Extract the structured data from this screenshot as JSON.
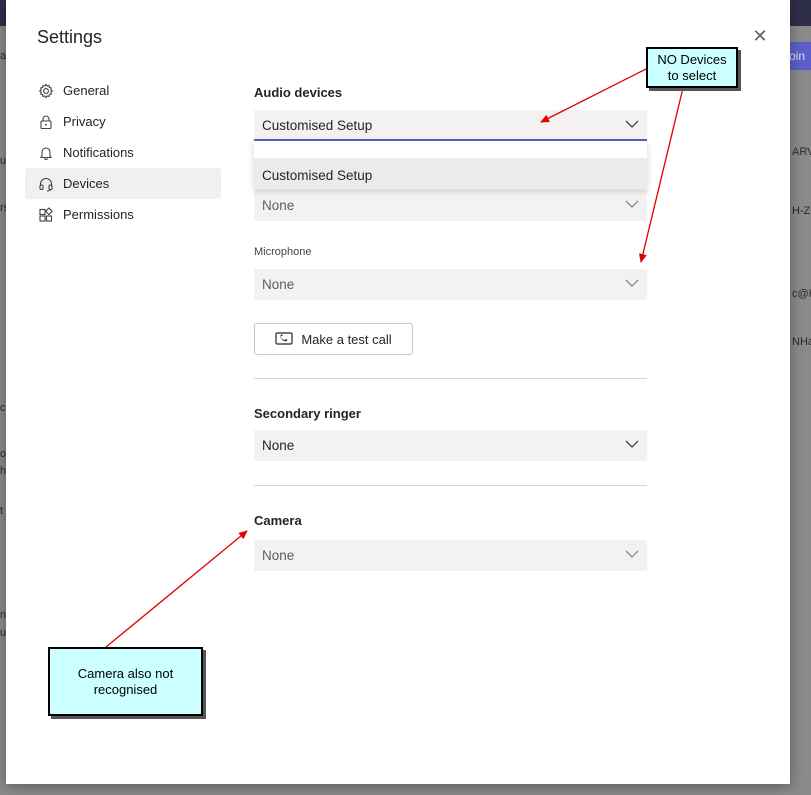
{
  "background": {
    "join_fragment": "oin",
    "fragments": [
      "a",
      "u",
      "rs",
      "ARV",
      "H-Z",
      "c@H",
      "NHa",
      "c",
      "o",
      "h",
      "t",
      "n",
      "u"
    ]
  },
  "dialog": {
    "title": "Settings",
    "close_glyph": "✕"
  },
  "sidebar": {
    "items": [
      {
        "label": "General",
        "icon": "gear-icon"
      },
      {
        "label": "Privacy",
        "icon": "lock-icon"
      },
      {
        "label": "Notifications",
        "icon": "bell-icon"
      },
      {
        "label": "Devices",
        "icon": "headset-icon",
        "active": true
      },
      {
        "label": "Permissions",
        "icon": "apps-icon"
      }
    ]
  },
  "devices": {
    "audio_devices_title": "Audio devices",
    "audio_devices_value": "Customised Setup",
    "dropdown_options": [
      "Customised Setup"
    ],
    "speaker_value": "None",
    "microphone_label": "Microphone",
    "microphone_value": "None",
    "test_call_label": "Make a test call",
    "secondary_ringer_title": "Secondary ringer",
    "secondary_ringer_value": "None",
    "camera_title": "Camera",
    "camera_value": "None"
  },
  "annotations": {
    "no_devices_line1": "NO Devices",
    "no_devices_line2": "to select",
    "camera_line1": "Camera also not",
    "camera_line2": "recognised",
    "arrow_color": "#e00000"
  },
  "colors": {
    "accent": "#5b5fc7",
    "callout_bg": "#ccffff",
    "select_bg": "#f3f2f1"
  }
}
